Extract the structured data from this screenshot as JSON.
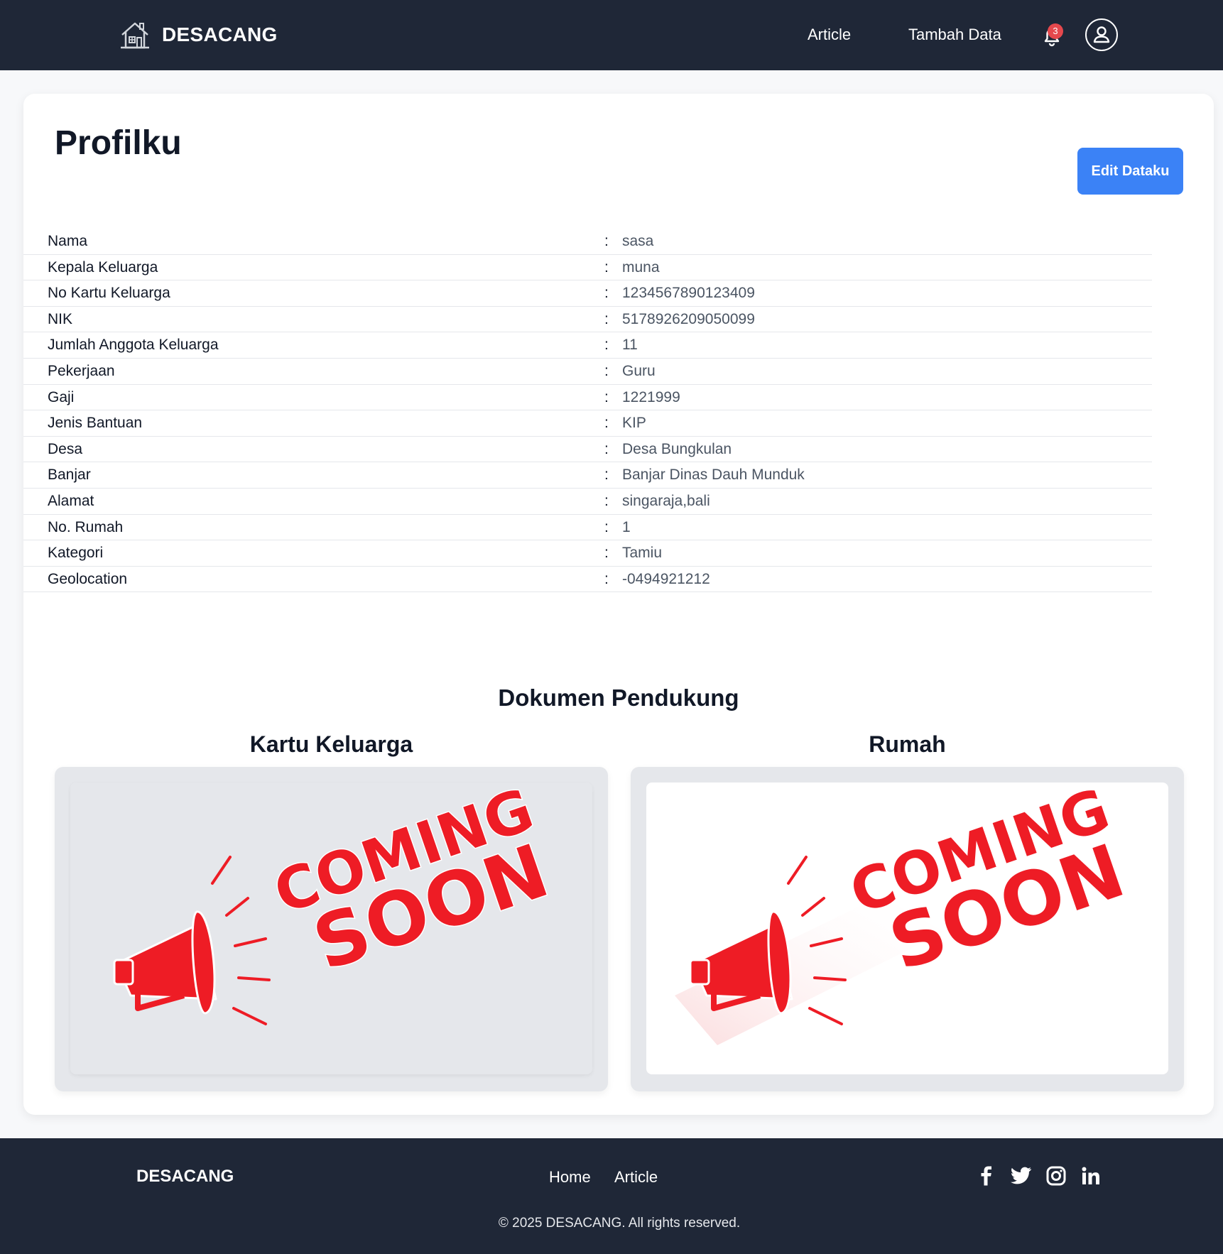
{
  "navbar": {
    "brand": "DESACANG",
    "links": [
      "Article",
      "Tambah Data"
    ],
    "notification_count": "3"
  },
  "profile": {
    "title": "Profilku",
    "edit_button": "Edit Dataku",
    "fields": [
      {
        "label": "Nama",
        "value": "sasa"
      },
      {
        "label": "Kepala Keluarga",
        "value": "muna"
      },
      {
        "label": "No Kartu Keluarga",
        "value": "1234567890123409"
      },
      {
        "label": "NIK",
        "value": "5178926209050099"
      },
      {
        "label": "Jumlah Anggota Keluarga",
        "value": "11"
      },
      {
        "label": "Pekerjaan",
        "value": "Guru"
      },
      {
        "label": "Gaji",
        "value": "1221999"
      },
      {
        "label": "Jenis Bantuan",
        "value": "KIP"
      },
      {
        "label": "Desa",
        "value": "Desa Bungkulan"
      },
      {
        "label": "Banjar",
        "value": "Banjar Dinas Dauh Munduk"
      },
      {
        "label": "Alamat",
        "value": "singaraja,bali"
      },
      {
        "label": "No. Rumah",
        "value": "1"
      },
      {
        "label": "Kategori",
        "value": "Tamiu"
      },
      {
        "label": "Geolocation",
        "value": "-0494921212"
      }
    ],
    "separator": ":"
  },
  "documents": {
    "title": "Dokumen Pendukung",
    "items": [
      {
        "title": "Kartu Keluarga",
        "image_line1": "COMING",
        "image_line2": "SOON"
      },
      {
        "title": "Rumah",
        "image_line1": "COMING",
        "image_line2": "SOON"
      }
    ]
  },
  "footer": {
    "brand": "DESACANG",
    "links": [
      "Home",
      "Article"
    ],
    "social_icons": [
      "facebook-icon",
      "twitter-icon",
      "instagram-icon",
      "linkedin-icon"
    ],
    "copyright": "© 2025 DESACANG. All rights reserved."
  },
  "colors": {
    "nav_bg": "#1f2737",
    "accent": "#3b82f6",
    "badge": "#e5484d",
    "coming_soon_red": "#ee1c25"
  }
}
